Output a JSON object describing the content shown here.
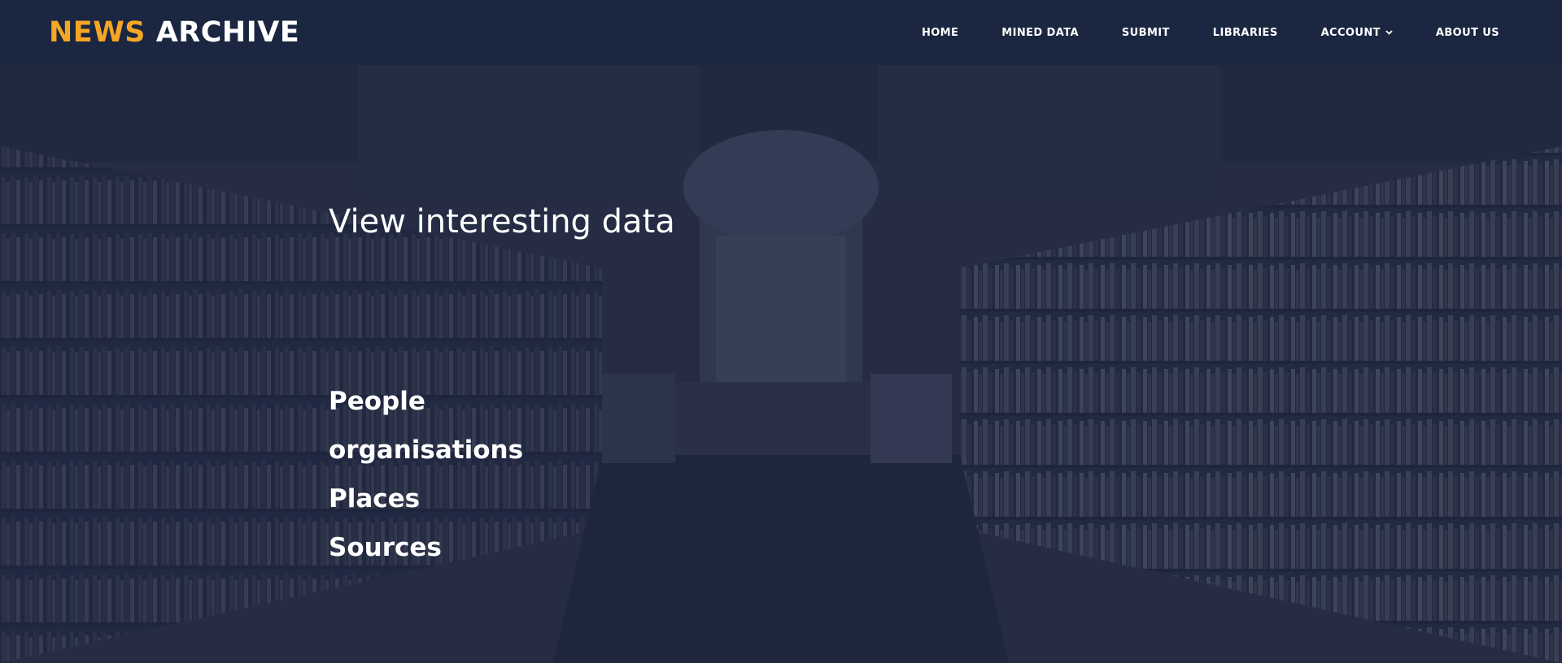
{
  "header": {
    "logo_accent": "NEWS",
    "logo_main": "ARCHIVE",
    "accent_color": "#f5a623",
    "background_color": "#1b2641"
  },
  "nav": {
    "items": [
      {
        "label": "HOME"
      },
      {
        "label": "MINED DATA"
      },
      {
        "label": "SUBMIT"
      },
      {
        "label": "LIBRARIES"
      },
      {
        "label": "ACCOUNT",
        "icon": "chevron-down-icon"
      },
      {
        "label": "ABOUT US"
      }
    ]
  },
  "hero": {
    "title": "View interesting data",
    "links": [
      {
        "label": "People"
      },
      {
        "label": "organisations"
      },
      {
        "label": "Places"
      },
      {
        "label": "Sources"
      }
    ]
  },
  "background": {
    "image": "library-bookshelves-photo",
    "overlay_color": "#1b2642"
  }
}
